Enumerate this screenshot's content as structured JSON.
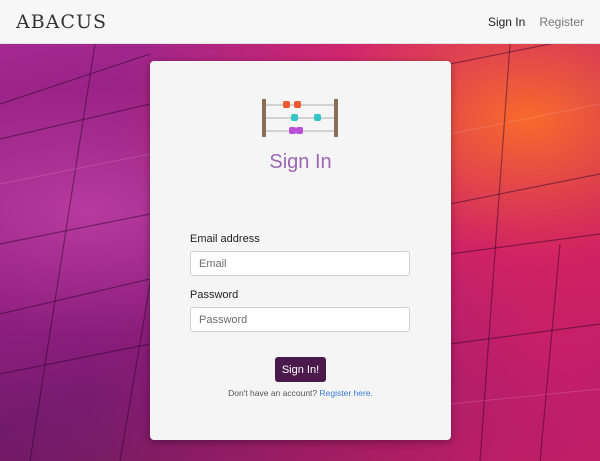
{
  "navbar": {
    "brand": "ABACUS",
    "links": [
      {
        "label": "Sign In",
        "active": true
      },
      {
        "label": "Register",
        "active": false
      }
    ]
  },
  "card": {
    "title": "Sign In",
    "email": {
      "label": "Email address",
      "placeholder": "Email",
      "value": ""
    },
    "password": {
      "label": "Password",
      "placeholder": "Password",
      "value": ""
    },
    "submit_label": "Sign In!",
    "footer": {
      "prompt": "Don't have an account?",
      "link_label": "Register here."
    }
  },
  "colors": {
    "accent_title": "#9a67b2",
    "button": "#4b1a4c",
    "link": "#3a7bd5",
    "navbar": "#f7f7f7"
  },
  "icons": [
    "abacus-logo-icon"
  ]
}
